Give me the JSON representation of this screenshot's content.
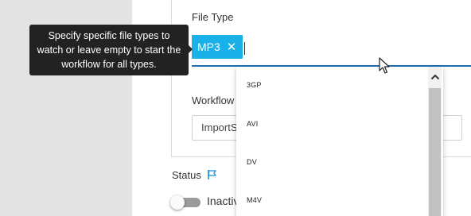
{
  "form": {
    "file_type_label": "File Type",
    "chips": [
      {
        "label": "MP3",
        "remove_glyph": "✕"
      }
    ],
    "workflow_label": "Workflow",
    "workflow_value": "ImportS",
    "status_label": "Status",
    "status_toggle_label": "Inactive"
  },
  "dropdown": {
    "options": [
      "3GP",
      "AVI",
      "DV",
      "M4V"
    ]
  },
  "tooltip": {
    "text": "Specify specific file types to watch or leave empty to start the workflow for all types."
  },
  "icons": {
    "flag": "flag-icon",
    "scroll_up": "chevron-up-icon",
    "cursor": "mouse-pointer-icon"
  },
  "colors": {
    "accent": "#1ab0e8",
    "underline": "#1e6fb3",
    "tooltip_bg": "#222222",
    "toggle_off": "#9b9b9b"
  }
}
